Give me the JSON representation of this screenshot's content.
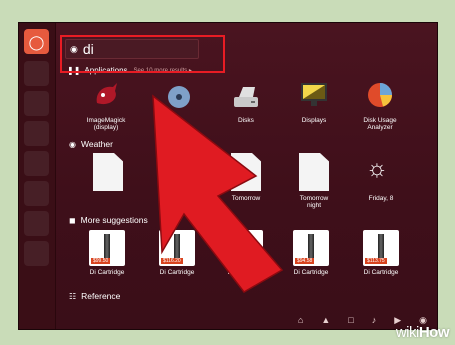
{
  "search": {
    "query": "di"
  },
  "filter": {
    "label": "Applications",
    "more": "See 10 more results ▸"
  },
  "apps": [
    {
      "label": "ImageMagick (display)"
    },
    {
      "label": ""
    },
    {
      "label": "Disks"
    },
    {
      "label": "Displays"
    },
    {
      "label": "Disk Usage Analyzer"
    }
  ],
  "sections": {
    "weather": "Weather",
    "suggestions": "More suggestions",
    "reference": "Reference"
  },
  "weather": [
    {
      "label": ""
    },
    {
      "label": ""
    },
    {
      "label": "Tomorrow"
    },
    {
      "label": "Tomorrow night"
    },
    {
      "label": "Friday, 8"
    }
  ],
  "suggestions": [
    {
      "label": "Di Cartridge",
      "price": "$99.50"
    },
    {
      "label": "Di Cartridge",
      "price": "$116.20"
    },
    {
      "label": "Di Cartridge",
      "price": ""
    },
    {
      "label": "Di Cartridge",
      "price": "$94.58"
    },
    {
      "label": "Di Cartridge",
      "price": "$113.75"
    }
  ],
  "watermark": {
    "wiki": "wiki",
    "how": "How"
  },
  "colors": {
    "accent": "#e81c24",
    "dash": "#3f0f1a",
    "background": "#c9dcb8"
  }
}
